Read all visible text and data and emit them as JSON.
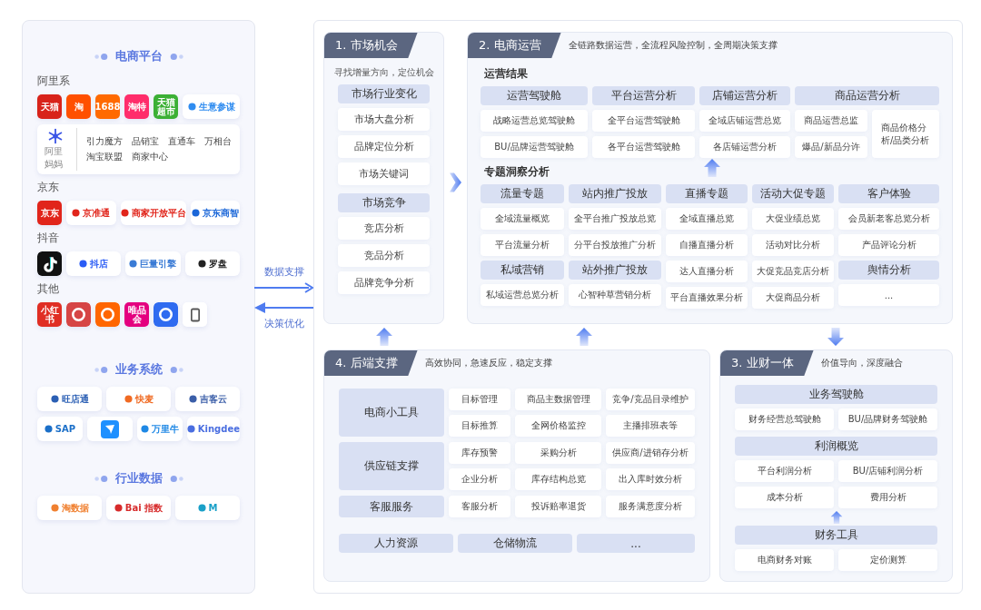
{
  "sources": [
    {
      "title": "电商平台",
      "groups": [
        {
          "label": "阿里系",
          "rows": [
            [
              {
                "kind": "tile",
                "text": "天猫",
                "color": "#d8231a"
              },
              {
                "kind": "tile",
                "text": "淘",
                "color": "#ff5000"
              },
              {
                "kind": "tile",
                "text": "1688",
                "color": "#ff6a00"
              },
              {
                "kind": "tile",
                "text": "淘特",
                "color": "#ff2d6b"
              },
              {
                "kind": "tile",
                "text": "天猫超市",
                "color": "#3cb035"
              },
              {
                "kind": "card",
                "text": "生意参谋",
                "color": "#2f8cf0"
              }
            ],
            [
              {
                "kind": "multi",
                "caption": "阿里妈妈",
                "color": "#3b55e6",
                "items": [
                  "引力魔方",
                  "品销宝",
                  "直通车",
                  "万相台",
                  "淘宝联盟",
                  "商家中心"
                ]
              }
            ]
          ]
        },
        {
          "label": "京东",
          "rows": [
            [
              {
                "kind": "tile",
                "text": "京东",
                "color": "#e1251b"
              },
              {
                "kind": "card",
                "text": "京准通",
                "color": "#e1251b"
              },
              {
                "kind": "card",
                "text": "商家开放平台",
                "color": "#e1251b"
              },
              {
                "kind": "card",
                "text": "京东商智",
                "color": "#1a66d8"
              }
            ]
          ]
        },
        {
          "label": "抖音",
          "rows": [
            [
              {
                "kind": "note",
                "color": "#111111"
              },
              {
                "kind": "card",
                "text": "抖店",
                "color": "#2a5cf5"
              },
              {
                "kind": "card",
                "text": "巨量引擎",
                "color": "#3a7bd5"
              },
              {
                "kind": "card",
                "text": "罗盘",
                "color": "#222222"
              }
            ]
          ]
        },
        {
          "label": "其他",
          "rows": [
            [
              {
                "kind": "tile",
                "text": "小红书",
                "color": "#e02e24"
              },
              {
                "kind": "glyph",
                "color": "#d64545"
              },
              {
                "kind": "glyph",
                "color": "#ff6600"
              },
              {
                "kind": "tile",
                "text": "唯品会",
                "color": "#e4007f"
              },
              {
                "kind": "glyph",
                "color": "#2f6bf0"
              },
              {
                "kind": "phone",
                "color": "#555555"
              }
            ]
          ]
        }
      ]
    },
    {
      "title": "业务系统",
      "groups": [
        {
          "rows": [
            [
              {
                "kind": "card",
                "text": "旺店通",
                "color": "#2b5fb4"
              },
              {
                "kind": "card",
                "text": "快麦",
                "color": "#f06a22"
              },
              {
                "kind": "card",
                "text": "吉客云",
                "color": "#3a5ea8"
              }
            ]
          ]
        },
        {
          "rows": [
            [
              {
                "kind": "card",
                "text": "SAP",
                "color": "#1b6fc8"
              },
              {
                "kind": "glyphcard",
                "color": "#1e90ff"
              },
              {
                "kind": "card",
                "text": "万里牛",
                "color": "#1e88e5"
              },
              {
                "kind": "card",
                "text": "Kingdee",
                "color": "#4a6ee0"
              }
            ]
          ]
        }
      ]
    },
    {
      "title": "行业数据",
      "groups": [
        {
          "rows": [
            [
              {
                "kind": "card",
                "text": "淘数据",
                "color": "#f08030"
              },
              {
                "kind": "card",
                "text": "Bai 指数",
                "color": "#d72b2b"
              },
              {
                "kind": "card",
                "text": "M",
                "color": "#1aa0c8"
              }
            ]
          ]
        }
      ]
    }
  ],
  "flows": [
    {
      "kind": "right",
      "label": "数据支撑"
    },
    {
      "kind": "left",
      "label": "决策优化"
    }
  ],
  "stage1": {
    "title": "1. 市场机会",
    "subtitle": "寻找增量方向，定位机会",
    "blocks": [
      {
        "header": "市场行业变化",
        "items": [
          "市场大盘分析",
          "品牌定位分析",
          "市场关键词"
        ]
      },
      {
        "header": "市场竞争",
        "items": [
          "竞店分析",
          "竞品分析",
          "品牌竞争分析"
        ]
      }
    ]
  },
  "stage2": {
    "title": "2. 电商运营",
    "subtitle": "全链路数据运营，全流程风险控制，全周期决策支撑",
    "sections": [
      {
        "heading": "运营结果",
        "columns": [
          {
            "kind": "list",
            "blocks": [
              {
                "header": "运营驾驶舱",
                "items": [
                  "战略运营总览驾驶舱",
                  "BU/品牌运营驾驶舱"
                ]
              }
            ]
          },
          {
            "kind": "list",
            "blocks": [
              {
                "header": "平台运营分析",
                "items": [
                  "全平台运营驾驶舱",
                  "各平台运营驾驶舱"
                ]
              }
            ]
          },
          {
            "kind": "list",
            "blocks": [
              {
                "header": "店铺运营分析",
                "items": [
                  "全域店铺运营总览",
                  "各店铺运营分析"
                ]
              }
            ]
          },
          {
            "kind": "split",
            "blocks": [
              {
                "header": "商品运营分析",
                "items": [
                  "商品运营总监",
                  "爆品/新品分许",
                  "商品价格分析/品类分析"
                ]
              }
            ]
          }
        ]
      },
      {
        "heading": "专题洞察分析",
        "columns": [
          {
            "kind": "list",
            "blocks": [
              {
                "header": "流量专题",
                "items": [
                  "全域流量概览",
                  "平台流量分析"
                ]
              },
              {
                "header": "私域营销",
                "items": [
                  "私域运营总览分析"
                ]
              }
            ]
          },
          {
            "kind": "list",
            "blocks": [
              {
                "header": "站内推广投放",
                "items": [
                  "全平台推广投放总览",
                  "分平台投放推广分析"
                ]
              },
              {
                "header": "站外推广投放",
                "items": [
                  "心智种草营销分析"
                ]
              }
            ]
          },
          {
            "kind": "list",
            "blocks": [
              {
                "header": "直播专题",
                "items": [
                  "全域直播总览",
                  "自播直播分析",
                  "达人直播分析",
                  "平台直播效果分析"
                ]
              }
            ]
          },
          {
            "kind": "list",
            "blocks": [
              {
                "header": "活动大促专题",
                "items": [
                  "大促业绩总览",
                  "活动对比分析",
                  "大促竞品竞店分析",
                  "大促商品分析"
                ]
              }
            ]
          },
          {
            "kind": "list",
            "blocks": [
              {
                "header": "客户体验",
                "items": [
                  "会员新老客总览分析",
                  "产品评论分析"
                ]
              },
              {
                "header": "舆情分析",
                "items": [
                  "..."
                ]
              }
            ]
          }
        ]
      }
    ]
  },
  "stage3": {
    "title": "3. 业财一体",
    "subtitle": "价值导向，深度融合",
    "blocks": [
      {
        "header": "业务驾驶舱",
        "items": [
          "财务经营总驾驶舱",
          "BU/品牌财务驾驶舱"
        ]
      },
      {
        "header": "利润概览",
        "items": [
          "平台利润分析",
          "BU/店铺利润分析",
          "成本分析",
          "费用分析"
        ]
      },
      {
        "header": "财务工具",
        "items": [
          "电商财务对账",
          "定价测算"
        ]
      }
    ]
  },
  "stage4": {
    "title": "4. 后端支撑",
    "subtitle": "高效协同，急速反应，稳定支撑",
    "rows": [
      {
        "header": "电商小工具",
        "items": [
          "目标管理",
          "商品主数据管理",
          "竞争/竞品目录维护",
          "目标推算",
          "全网价格监控",
          "主播排班表等"
        ]
      },
      {
        "header": "供应链支撑",
        "items": [
          "库存预警",
          "采购分析",
          "供应商/进销存分析",
          "企业分析",
          "库存结构总览",
          "出入库时效分析"
        ]
      },
      {
        "header": "客服服务",
        "items": [
          "客服分析",
          "投诉赔率退货",
          "服务满意度分析"
        ]
      }
    ],
    "footer": [
      "人力资源",
      "仓储物流",
      "..."
    ]
  }
}
